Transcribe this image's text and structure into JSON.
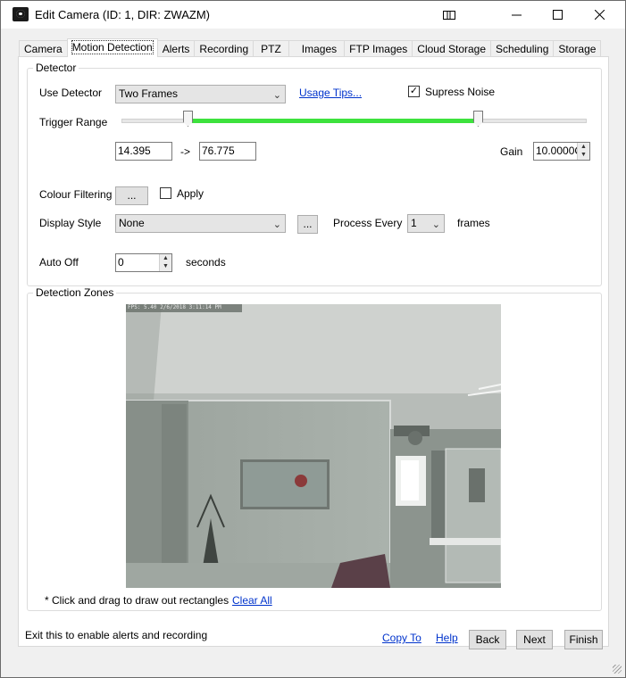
{
  "window": {
    "title": "Edit Camera (ID: 1, DIR: ZWAZM)"
  },
  "tabs": [
    {
      "label": "Camera"
    },
    {
      "label": "Motion Detection",
      "active": true
    },
    {
      "label": "Alerts"
    },
    {
      "label": "Recording"
    },
    {
      "label": "PTZ"
    },
    {
      "label": "Images"
    },
    {
      "label": "FTP Images"
    },
    {
      "label": "Cloud Storage"
    },
    {
      "label": "Scheduling"
    },
    {
      "label": "Storage"
    }
  ],
  "detector": {
    "group_label": "Detector",
    "use_detector_label": "Use Detector",
    "use_detector_value": "Two Frames",
    "usage_tips_link": "Usage Tips...",
    "suppress_noise_label": "Supress Noise",
    "suppress_noise_checked": true,
    "trigger_range_label": "Trigger Range",
    "trigger_min": "14.395",
    "range_arrow": "->",
    "trigger_max": "76.775",
    "gain_label": "Gain",
    "gain_value": "10.0000C",
    "colour_filtering_label": "Colour Filtering",
    "colour_filtering_button": "...",
    "apply_label": "Apply",
    "apply_checked": false,
    "display_style_label": "Display Style",
    "display_style_value": "None",
    "display_style_button": "...",
    "process_every_label": "Process Every",
    "process_every_value": "1",
    "frames_label": "frames",
    "auto_off_label": "Auto Off",
    "auto_off_value": "0",
    "seconds_label": "seconds"
  },
  "detection_zones": {
    "group_label": "Detection Zones",
    "overlay_text": "FPS: 5.40 2/6/2018 3:11:14 PM",
    "hint": "* Click and drag to draw out rectangles",
    "clear_all_link": "Clear All"
  },
  "footer": {
    "status_text": "Exit this to enable alerts and recording",
    "copy_to_link": "Copy To",
    "help_link": "Help",
    "back_button": "Back",
    "next_button": "Next",
    "finish_button": "Finish"
  },
  "colors": {
    "range_green": "#3de23d",
    "link_blue": "#0033cc"
  }
}
